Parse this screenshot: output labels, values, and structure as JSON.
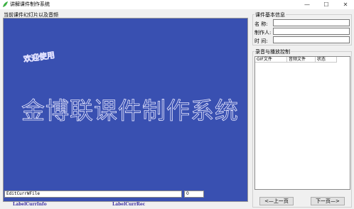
{
  "window": {
    "title": "讲解课件制作系统",
    "minimize": "—",
    "maximize": "☐",
    "close": "✕"
  },
  "left": {
    "group_title": "当前课件幻灯片以及音频",
    "slide": {
      "welcome": "欢迎使用",
      "title": "金博联课件制作系统"
    },
    "edit_file": "EditCurrWFile",
    "edit_rec": "0",
    "label_info": "LabelCurrInfo",
    "label_rec": "LabelCurrRec"
  },
  "right": {
    "info_title": "课件基本信息",
    "name_label": "名  称:",
    "author_label": "制作人:",
    "time_label": "时  间:",
    "name_value": "",
    "author_value": "",
    "time_value": "",
    "control_title": "录音与播放控制",
    "columns": [
      "GIF文件",
      "音频文件",
      "状态"
    ],
    "prev_button": "<—上一页",
    "next_button": "下一页—>"
  },
  "colors": {
    "slide_bg": "#3950b1",
    "status_text": "#3b2ea0",
    "icon_green": "#3cb043"
  }
}
